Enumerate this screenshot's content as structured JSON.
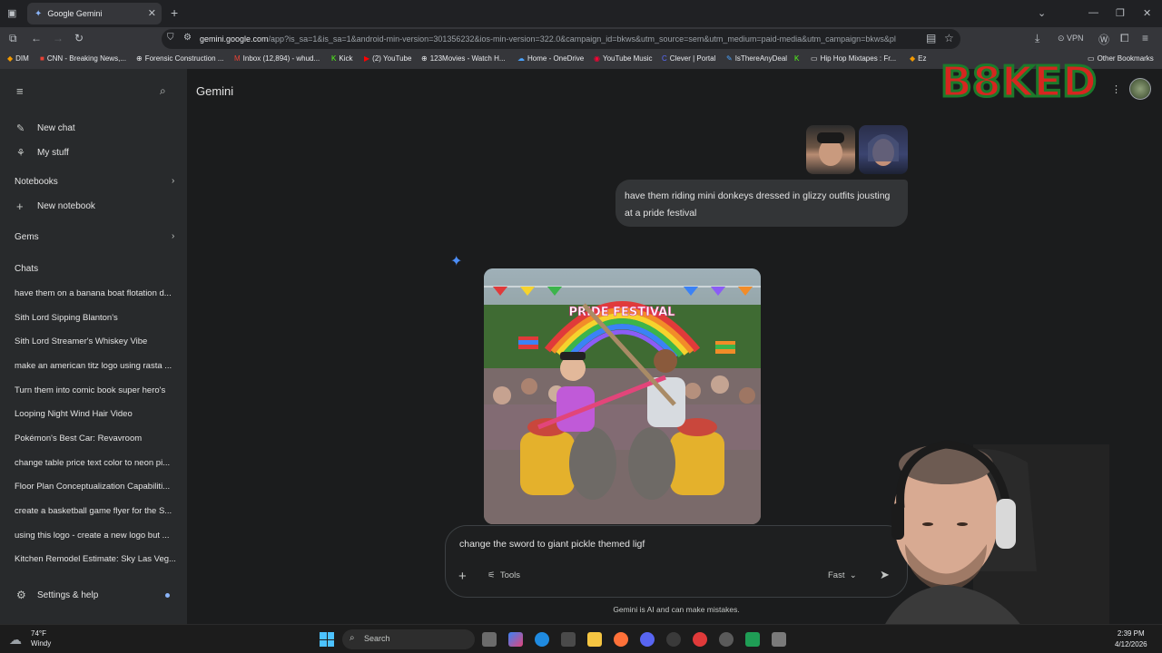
{
  "browser": {
    "tab_title": "Google Gemini",
    "url_domain": "gemini.google.com",
    "url_rest": "/app?is_sa=1&is_sa=1&android-min-version=301356232&ios-min-version=322.0&campaign_id=bkws&utm_source=sem&utm_medium=paid-media&utm_campaign=bkws&pl",
    "vpn_label": "VPN",
    "bookmarks": [
      "DIM",
      "CNN - Breaking News,...",
      "Forensic Construction ...",
      "Inbox (12,894) - whud...",
      "Kick",
      "(2) YouTube",
      "123Movies - Watch H...",
      "Home - OneDrive",
      "YouTube Music",
      "Clever | Portal",
      "IsThereAnyDeal",
      "Hip Hop Mixtapes : Fr...",
      "Ez",
      "Other Bookmarks"
    ]
  },
  "sidebar": {
    "new_chat": "New chat",
    "my_stuff": "My stuff",
    "notebooks": "Notebooks",
    "new_notebook": "New notebook",
    "gems": "Gems",
    "chats_heading": "Chats",
    "chats": [
      "have them on a banana boat flotation d...",
      "Sith Lord Sipping Blanton's",
      "Sith Lord Streamer's Whiskey Vibe",
      "make an american titz logo using rasta ...",
      "Turn them into comic book super hero's",
      "Looping Night Wind Hair Video",
      "Pokémon's Best Car: Revavroom",
      "change table price text color to neon pi...",
      "Floor Plan Conceptualization Capabiliti...",
      "create a basketball game flyer for the S...",
      "using this logo - create a new logo but ...",
      "Kitchen Remodel Estimate: Sky Las Veg..."
    ],
    "settings": "Settings & help"
  },
  "main": {
    "title": "Gemini",
    "user_message": "have them riding mini donkeys dressed in glizzy outfits jousting at a pride festival",
    "image_banner": "PRIDE FESTIVAL",
    "composer": {
      "text": "change the sword to giant pickle themed ligf",
      "tools": "Tools",
      "mode": "Fast"
    },
    "disclaimer": "Gemini is AI and can make mistakes."
  },
  "overlay": {
    "logo_text": "B8KED"
  },
  "taskbar": {
    "weather_temp": "74°F",
    "weather_desc": "Windy",
    "search": "Search",
    "time": "2:39 PM",
    "date": "4/12/2026"
  },
  "colors": {
    "accent": "#4c8df6",
    "sidebar_bg": "#282a2c",
    "main_bg": "#1b1c1d"
  }
}
